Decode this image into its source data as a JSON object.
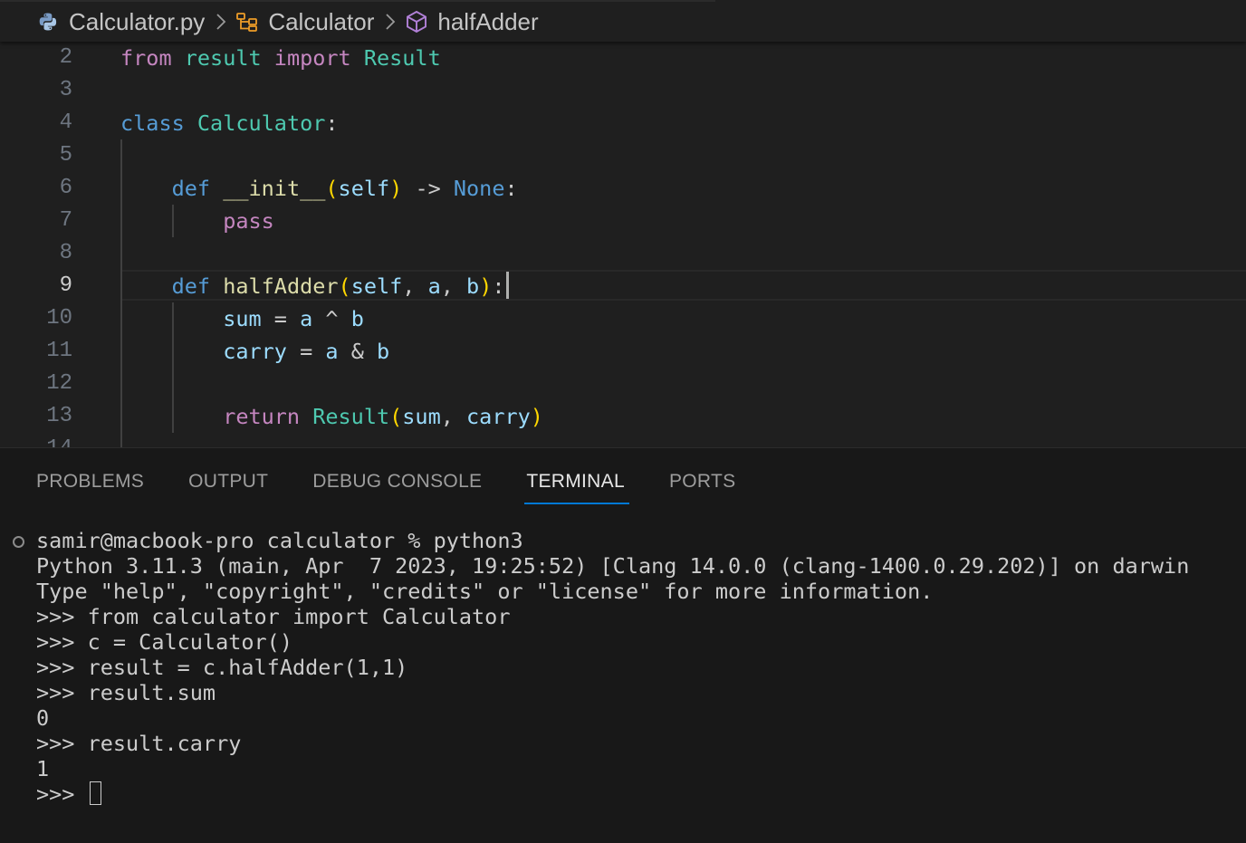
{
  "breadcrumb": {
    "file": "Calculator.py",
    "class": "Calculator",
    "method": "halfAdder",
    "icons": [
      "python-file-icon",
      "symbol-class-icon",
      "symbol-method-icon",
      "chevron-right-icon"
    ]
  },
  "editor": {
    "active_line": "9",
    "lines": [
      {
        "n": "2",
        "tokens": [
          {
            "t": "from",
            "c": "kw-purple"
          },
          {
            "t": " "
          },
          {
            "t": "result",
            "c": "cls"
          },
          {
            "t": " "
          },
          {
            "t": "import",
            "c": "kw-purple"
          },
          {
            "t": " "
          },
          {
            "t": "Result",
            "c": "cls"
          }
        ]
      },
      {
        "n": "3",
        "tokens": []
      },
      {
        "n": "4",
        "tokens": [
          {
            "t": "class",
            "c": "kw-blue"
          },
          {
            "t": " "
          },
          {
            "t": "Calculator",
            "c": "cls"
          },
          {
            "t": ":"
          }
        ]
      },
      {
        "n": "5",
        "tokens": []
      },
      {
        "n": "6",
        "tokens": [
          {
            "t": "    "
          },
          {
            "t": "def",
            "c": "kw-blue"
          },
          {
            "t": " "
          },
          {
            "t": "__init__",
            "c": "fn"
          },
          {
            "t": "(",
            "c": "br"
          },
          {
            "t": "self",
            "c": "var"
          },
          {
            "t": ")",
            "c": "br"
          },
          {
            "t": " -> "
          },
          {
            "t": "None",
            "c": "kw-blue"
          },
          {
            "t": ":"
          }
        ]
      },
      {
        "n": "7",
        "tokens": [
          {
            "t": "        "
          },
          {
            "t": "pass",
            "c": "kw-purple"
          }
        ]
      },
      {
        "n": "8",
        "tokens": []
      },
      {
        "n": "9",
        "tokens": [
          {
            "t": "    "
          },
          {
            "t": "def",
            "c": "kw-blue"
          },
          {
            "t": " "
          },
          {
            "t": "halfAdder",
            "c": "fn"
          },
          {
            "t": "(",
            "c": "br"
          },
          {
            "t": "self",
            "c": "var"
          },
          {
            "t": ", "
          },
          {
            "t": "a",
            "c": "var"
          },
          {
            "t": ", "
          },
          {
            "t": "b",
            "c": "var"
          },
          {
            "t": ")",
            "c": "br"
          },
          {
            "t": ":"
          }
        ],
        "cursor": true
      },
      {
        "n": "10",
        "tokens": [
          {
            "t": "        "
          },
          {
            "t": "sum",
            "c": "var"
          },
          {
            "t": " = "
          },
          {
            "t": "a",
            "c": "var"
          },
          {
            "t": " ^ "
          },
          {
            "t": "b",
            "c": "var"
          }
        ]
      },
      {
        "n": "11",
        "tokens": [
          {
            "t": "        "
          },
          {
            "t": "carry",
            "c": "var"
          },
          {
            "t": " = "
          },
          {
            "t": "a",
            "c": "var"
          },
          {
            "t": " & "
          },
          {
            "t": "b",
            "c": "var"
          }
        ]
      },
      {
        "n": "12",
        "tokens": []
      },
      {
        "n": "13",
        "tokens": [
          {
            "t": "        "
          },
          {
            "t": "return",
            "c": "kw-purple"
          },
          {
            "t": " "
          },
          {
            "t": "Result",
            "c": "cls"
          },
          {
            "t": "(",
            "c": "br"
          },
          {
            "t": "sum",
            "c": "var"
          },
          {
            "t": ", "
          },
          {
            "t": "carry",
            "c": "var"
          },
          {
            "t": ")",
            "c": "br"
          }
        ]
      },
      {
        "n": "14",
        "tokens": []
      }
    ]
  },
  "panel": {
    "tabs": [
      {
        "label": "PROBLEMS",
        "active": false
      },
      {
        "label": "OUTPUT",
        "active": false
      },
      {
        "label": "DEBUG CONSOLE",
        "active": false
      },
      {
        "label": "TERMINAL",
        "active": true
      },
      {
        "label": "PORTS",
        "active": false
      }
    ],
    "terminal_lines": [
      "samir@macbook-pro calculator % python3",
      "Python 3.11.3 (main, Apr  7 2023, 19:25:52) [Clang 14.0.0 (clang-1400.0.29.202)] on darwin",
      "Type \"help\", \"copyright\", \"credits\" or \"license\" for more information.",
      ">>> from calculator import Calculator",
      ">>> c = Calculator()",
      ">>> result = c.halfAdder(1,1)",
      ">>> result.sum",
      "0",
      ">>> result.carry",
      "1"
    ],
    "prompt": ">>> "
  }
}
